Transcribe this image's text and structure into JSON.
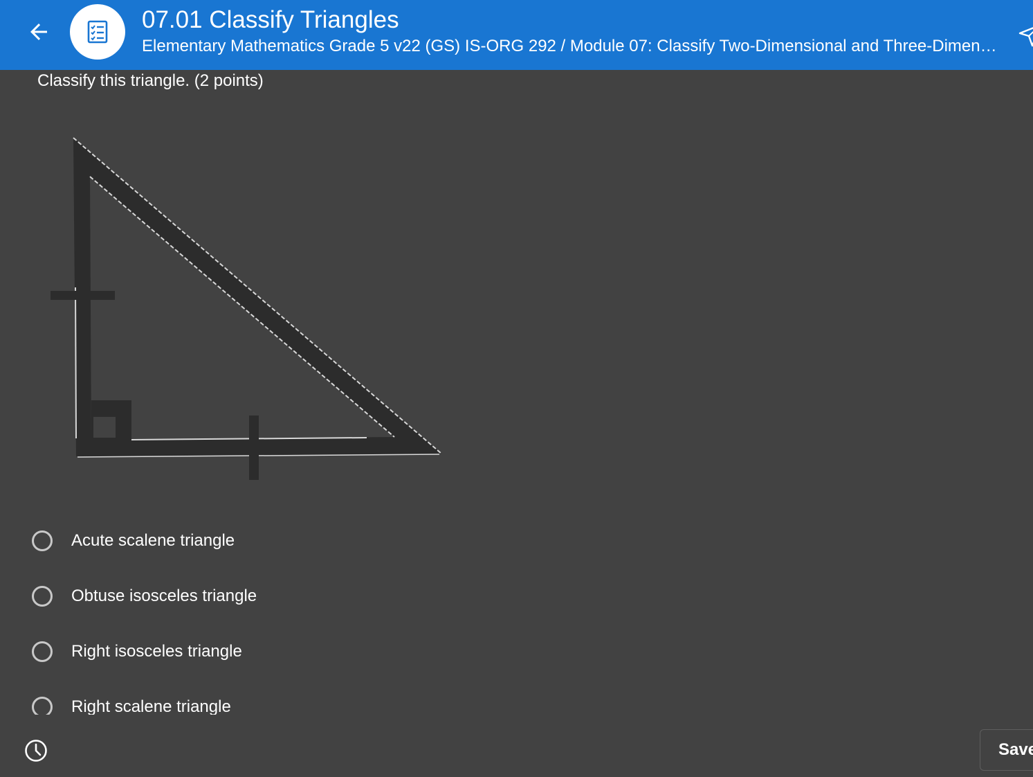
{
  "header": {
    "title": "07.01 Classify Triangles",
    "subtitle": "Elementary Mathematics Grade 5 v22 (GS) IS-ORG 292 / Module 07: Classify Two-Dimensional and Three-Dimensi...",
    "back_icon": "arrow-left-icon",
    "badge_icon": "checklist-icon",
    "send_icon": "send-icon"
  },
  "question": {
    "prompt": "Classify this triangle. (2 points)",
    "figure": {
      "shape": "right triangle",
      "marks": [
        "right-angle-marker",
        "tick-mark-vertical-leg",
        "tick-mark-horizontal-leg"
      ]
    },
    "options": [
      {
        "label": "Acute scalene triangle",
        "selected": false
      },
      {
        "label": "Obtuse isosceles triangle",
        "selected": false
      },
      {
        "label": "Right isosceles triangle",
        "selected": false
      },
      {
        "label": "Right scalene triangle",
        "selected": false
      }
    ]
  },
  "footer": {
    "timer_icon": "clock-icon",
    "save_label": "Save"
  },
  "colors": {
    "header_bg": "#1976d2",
    "page_bg": "#424242",
    "text": "#ffffff",
    "radio_border": "#c8c8c8"
  }
}
